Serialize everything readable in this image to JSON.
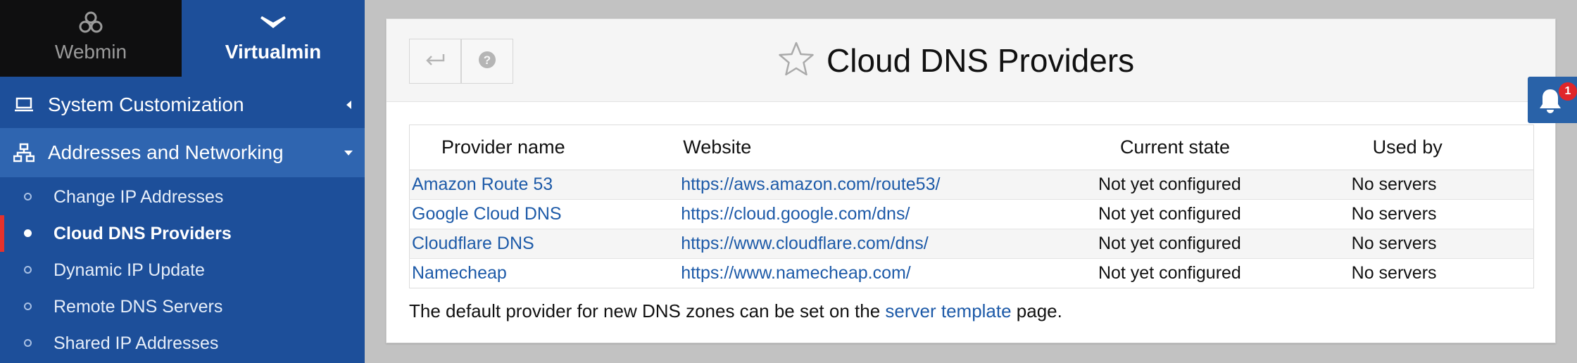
{
  "switcher": {
    "webmin_label": "Webmin",
    "virtualmin_label": "Virtualmin"
  },
  "menu": {
    "system_customization": "System Customization",
    "addresses_networking": "Addresses and Networking",
    "items": [
      {
        "label": "Change IP Addresses",
        "active": false
      },
      {
        "label": "Cloud DNS Providers",
        "active": true
      },
      {
        "label": "Dynamic IP Update",
        "active": false
      },
      {
        "label": "Remote DNS Servers",
        "active": false
      },
      {
        "label": "Shared IP Addresses",
        "active": false
      }
    ]
  },
  "page": {
    "title": "Cloud DNS Providers",
    "buttons": {
      "back_icon": "return-arrow-icon",
      "help_icon": "question-circle-icon"
    }
  },
  "table": {
    "headers": [
      "Provider name",
      "Website",
      "Current state",
      "Used by"
    ],
    "rows": [
      {
        "name": "Amazon Route 53",
        "website": "https://aws.amazon.com/route53/",
        "state": "Not yet configured",
        "used_by": "No servers"
      },
      {
        "name": "Google Cloud DNS",
        "website": "https://cloud.google.com/dns/",
        "state": "Not yet configured",
        "used_by": "No servers"
      },
      {
        "name": "Cloudflare DNS",
        "website": "https://www.cloudflare.com/dns/",
        "state": "Not yet configured",
        "used_by": "No servers"
      },
      {
        "name": "Namecheap",
        "website": "https://www.namecheap.com/",
        "state": "Not yet configured",
        "used_by": "No servers"
      }
    ]
  },
  "footer": {
    "text_before": "The default provider for new DNS zones can be set on the ",
    "link": "server template",
    "text_after": " page."
  },
  "notifications": {
    "count": "1"
  },
  "colors": {
    "sidebar": "#1d4f9a",
    "sidebar_active_section": "#2f65b0",
    "link": "#1d5aa8",
    "active_marker": "#e5322d",
    "badge": "#e0262a"
  }
}
